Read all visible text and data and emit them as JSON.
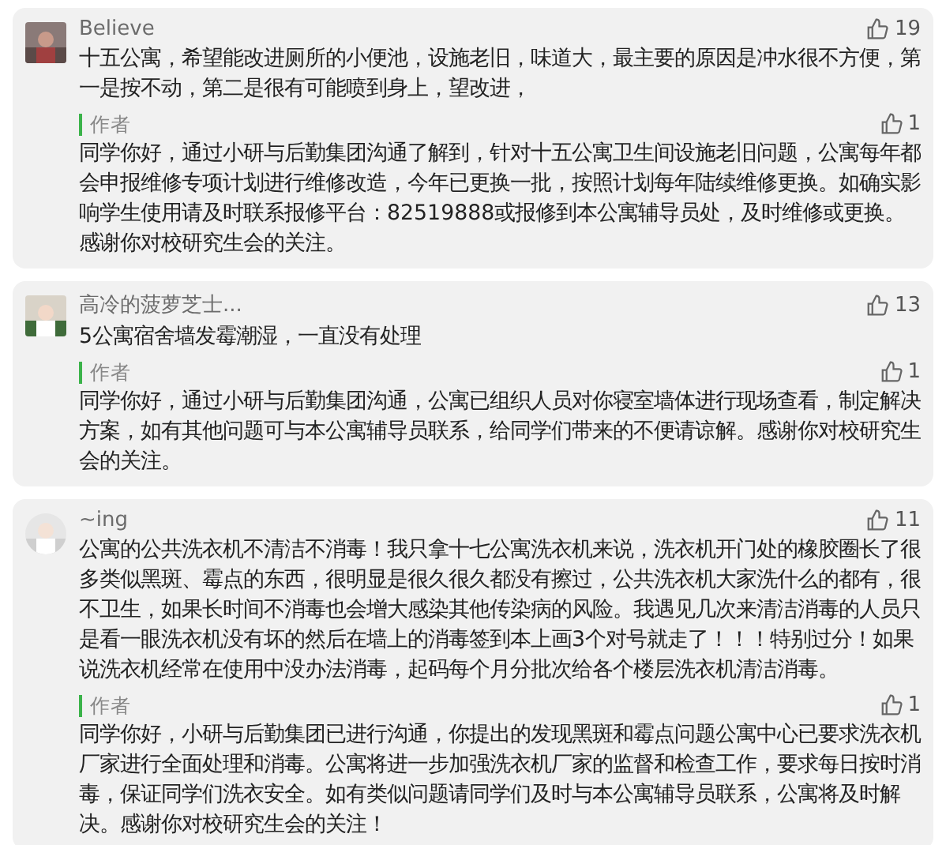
{
  "comments": [
    {
      "user": "Believe",
      "likes": "19",
      "text": "十五公寓，希望能改进厕所的小便池，设施老旧，味道大，最主要的原因是冲水很不方便，第一是按不动，第二是很有可能喷到身上，望改进，",
      "reply": {
        "author": "作者",
        "likes": "1",
        "text": "同学你好，通过小研与后勤集团沟通了解到，针对十五公寓卫生间设施老旧问题，公寓每年都会申报维修专项计划进行维修改造，今年已更换一批，按照计划每年陆续维修更换。如确实影响学生使用请及时联系报修平台：82519888或报修到本公寓辅导员处，及时维修或更换。感谢你对校研究生会的关注。"
      }
    },
    {
      "user": "高冷的菠萝芝士...",
      "likes": "13",
      "text": "5公寓宿舍墙发霉潮湿，一直没有处理",
      "reply": {
        "author": "作者",
        "likes": "1",
        "text": "同学你好，通过小研与后勤集团沟通，公寓已组织人员对你寝室墙体进行现场查看，制定解决方案，如有其他问题可与本公寓辅导员联系，给同学们带来的不便请谅解。感谢你对校研究生会的关注。"
      }
    },
    {
      "user": "~ing",
      "likes": "11",
      "text": "公寓的公共洗衣机不清洁不消毒！我只拿十七公寓洗衣机来说，洗衣机开门处的橡胶圈长了很多类似黑斑、霉点的东西，很明显是很久很久都没有擦过，公共洗衣机大家洗什么的都有，很不卫生，如果长时间不消毒也会增大感染其他传染病的风险。我遇见几次来清洁消毒的人员只是看一眼洗衣机没有坏的然后在墙上的消毒签到本上画3个对号就走了！！！特别过分！如果说洗衣机经常在使用中没办法消毒，起码每个月分批次给各个楼层洗衣机清洁消毒。",
      "reply": {
        "author": "作者",
        "likes": "1",
        "text": "同学你好，小研与后勤集团已进行沟通，你提出的发现黑斑和霉点问题公寓中心已要求洗衣机厂家进行全面处理和消毒。公寓将进一步加强洗衣机厂家的监督和检查工作，要求每日按时消毒，保证同学们洗衣安全。如有类似问题请同学们及时与本公寓辅导员联系，公寓将及时解决。感谢你对校研究生会的关注！"
      }
    }
  ]
}
